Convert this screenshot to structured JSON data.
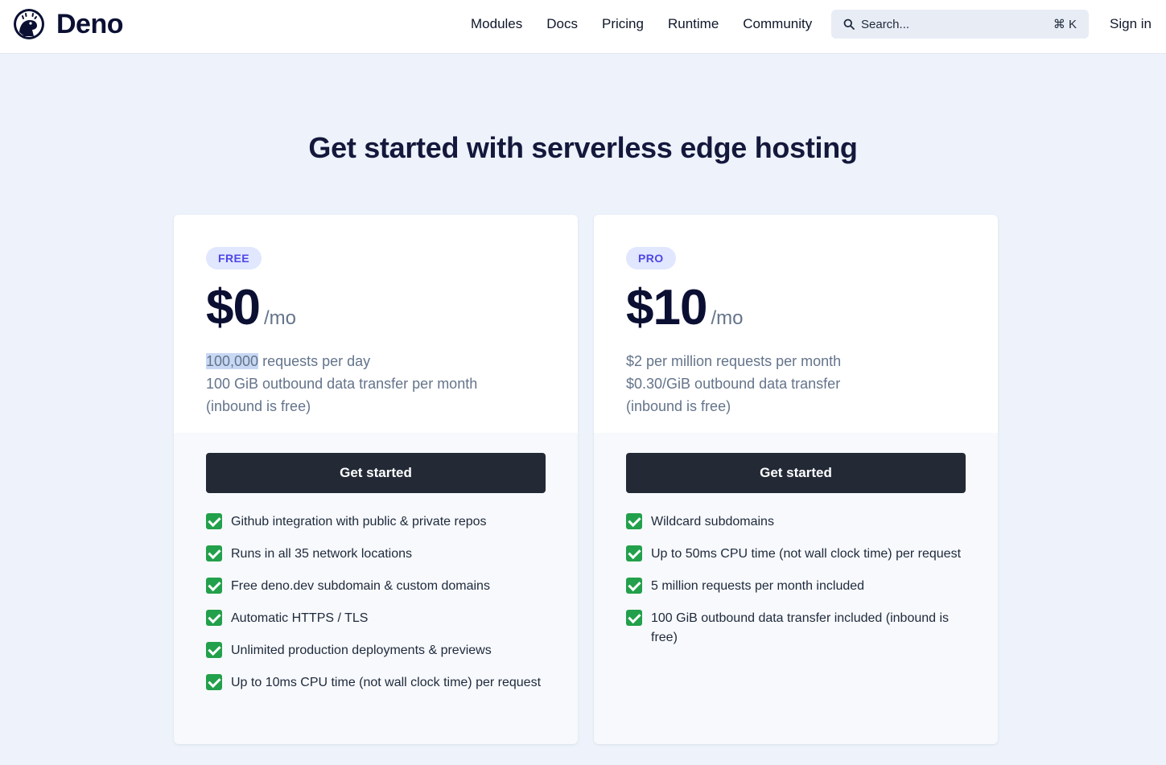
{
  "header": {
    "brand": "Deno",
    "nav": [
      "Modules",
      "Docs",
      "Pricing",
      "Runtime",
      "Community"
    ],
    "search": {
      "placeholder": "Search...",
      "shortcut": "⌘ K"
    },
    "signin": "Sign in"
  },
  "hero": {
    "title": "Get started with serverless edge hosting"
  },
  "plans": [
    {
      "badge": "FREE",
      "price": "$0",
      "period": "/mo",
      "desc": {
        "highlight": "100,000",
        "line1_rest": " requests per day",
        "line2": "100 GiB outbound data transfer per month",
        "line3": "(inbound is free)"
      },
      "cta": "Get started",
      "features": [
        "Github integration with public & private repos",
        "Runs in all 35 network locations",
        "Free deno.dev subdomain & custom domains",
        "Automatic HTTPS / TLS",
        "Unlimited production deployments & previews",
        "Up to 10ms CPU time (not wall clock time) per request"
      ]
    },
    {
      "badge": "PRO",
      "price": "$10",
      "period": "/mo",
      "desc": {
        "line1": "$2 per million requests per month",
        "line2": "$0.30/GiB outbound data transfer",
        "line3": "(inbound is free)"
      },
      "cta": "Get started",
      "features": [
        "Wildcard subdomains",
        "Up to 50ms CPU time (not wall clock time) per request",
        "5 million requests per month included",
        "100 GiB outbound data transfer included (inbound is free)"
      ]
    }
  ],
  "icons": {
    "logo": "deno-dinosaur-logo-icon",
    "search": "search-icon",
    "check": "check-mark-icon"
  },
  "colors": {
    "accent": "#4f46e5",
    "badge_bg": "#e0e7ff",
    "cta_bg": "#232a36",
    "check": "#22a04b",
    "page_bg": "#edf2fb"
  }
}
